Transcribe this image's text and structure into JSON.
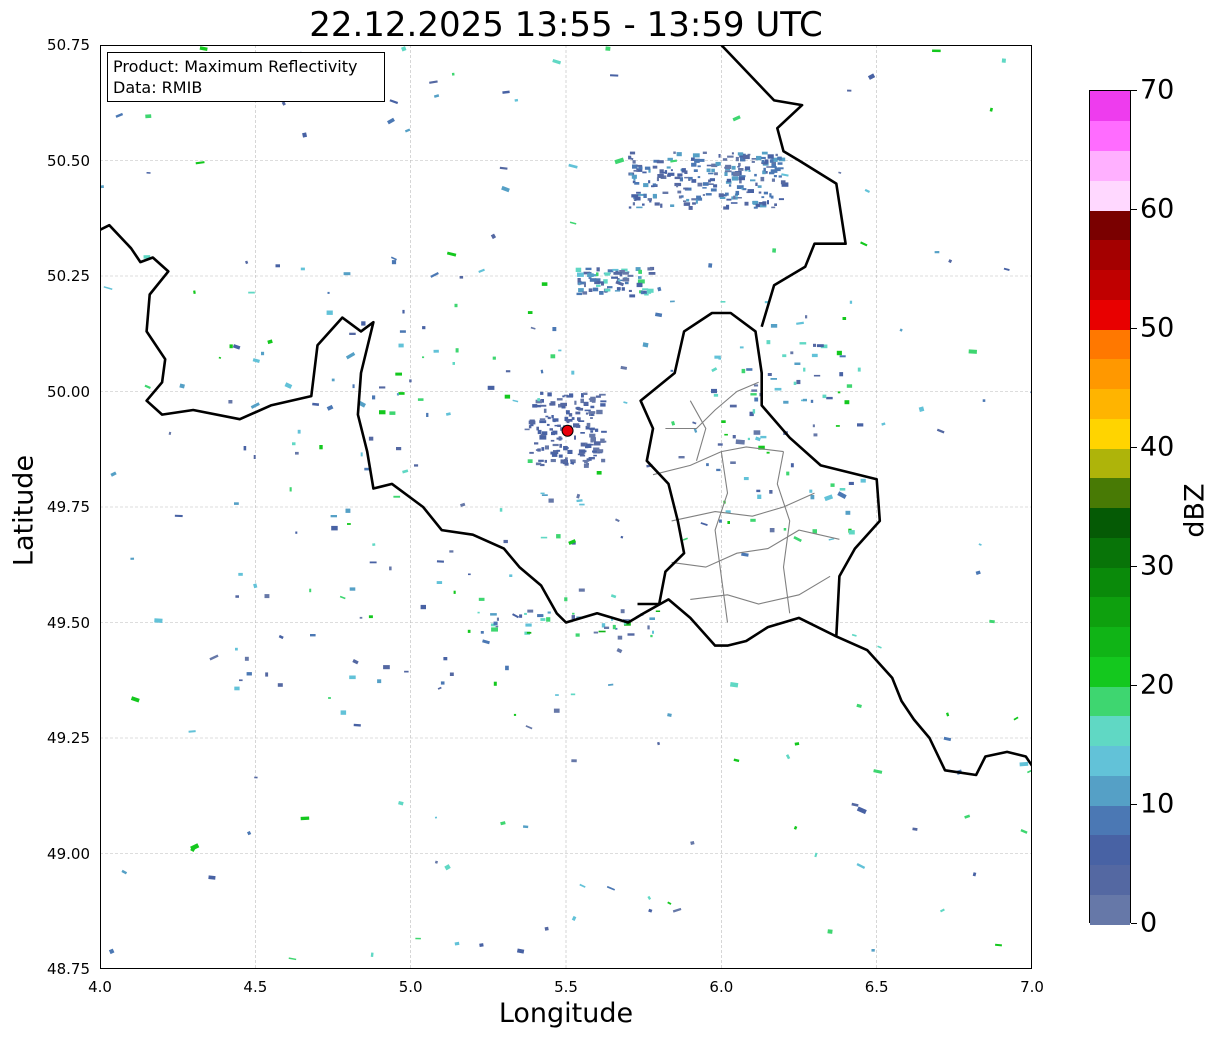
{
  "title": "22.12.2025 13:55 - 13:59 UTC",
  "info": {
    "product_line": "Product: Maximum Reflectivity",
    "data_line": "Data: RMIB"
  },
  "axes": {
    "xlabel": "Longitude",
    "ylabel": "Latitude",
    "xlim": [
      4.0,
      7.0
    ],
    "ylim": [
      48.75,
      50.75
    ],
    "xticks": [
      "4.0",
      "4.5",
      "5.0",
      "5.5",
      "6.0",
      "6.5",
      "7.0"
    ],
    "yticks": [
      "48.75",
      "49.00",
      "49.25",
      "49.50",
      "49.75",
      "50.00",
      "50.25",
      "50.50",
      "50.75"
    ],
    "grid": true
  },
  "radar_site": {
    "lon": 5.505,
    "lat": 49.915,
    "color": "#e8000b"
  },
  "colorbar": {
    "label": "dBZ",
    "min": 0,
    "max": 70,
    "step": 2.5,
    "tick_labels": [
      "0",
      "10",
      "20",
      "30",
      "40",
      "50",
      "60",
      "70"
    ],
    "colors": [
      "#6678a8",
      "#5468a2",
      "#4862a4",
      "#4b78b4",
      "#55a0c6",
      "#62c2d8",
      "#60d8c4",
      "#3ed670",
      "#14c81e",
      "#10b416",
      "#0ea00e",
      "#0a8a0a",
      "#087408",
      "#055a05",
      "#487a05",
      "#aeb40a",
      "#ffd400",
      "#ffb400",
      "#ff9800",
      "#ff7800",
      "#e80000",
      "#c00000",
      "#a40000",
      "#7a0000",
      "#ffd8ff",
      "#ffb0ff",
      "#ff6cff",
      "#ee3cee"
    ]
  },
  "map_style": {
    "border_color": "#000000",
    "district_color": "#808080",
    "grid_color": "#bbbbbb"
  }
}
